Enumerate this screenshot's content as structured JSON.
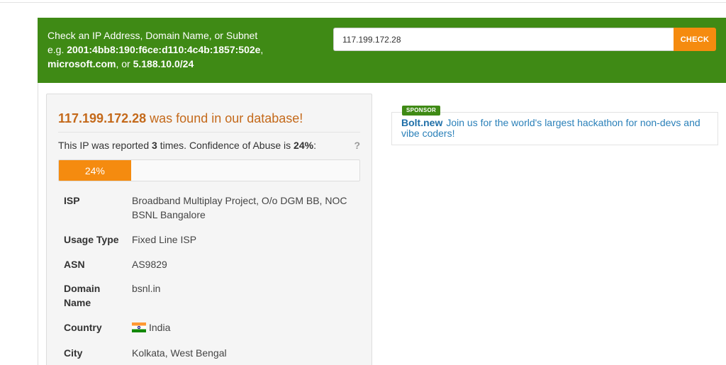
{
  "header": {
    "line1": "Check an IP Address, Domain Name, or Subnet",
    "eg_prefix": "e.g.",
    "example_ipv6": "2001:4bb8:190:f6ce:d110:4c4b:1857:502e",
    "comma1": ",",
    "example_domain": "microsoft.com",
    "or_text": ", or",
    "example_subnet": "5.188.10.0/24"
  },
  "search": {
    "value": "117.199.172.28",
    "button_label": "CHECK"
  },
  "result": {
    "ip": "117.199.172.28",
    "found_text": "was found in our database!",
    "report_prefix": "This IP was reported",
    "report_count": "3",
    "report_mid": "times. Confidence of Abuse is",
    "confidence": "24%",
    "report_suffix": ":",
    "help": "?",
    "progress_label": "24%",
    "progress_value": 24
  },
  "details": [
    {
      "key": "ISP",
      "value": "Broadband Multiplay Project, O/o DGM BB, NOC BSNL Bangalore"
    },
    {
      "key": "Usage Type",
      "value": "Fixed Line ISP"
    },
    {
      "key": "ASN",
      "value": "AS9829"
    },
    {
      "key": "Domain Name",
      "value": "bsnl.in"
    },
    {
      "key": "Country",
      "value": "India",
      "flag": "india-flag-icon"
    },
    {
      "key": "City",
      "value": "Kolkata, West Bengal"
    }
  ],
  "sponsor": {
    "badge": "SPONSOR",
    "brand": "Bolt.new",
    "text": "Join us for the world's largest hackathon for non-devs and vibe coders!"
  },
  "colors": {
    "header_green": "#3f8a15",
    "accent_orange": "#f58b0f",
    "title_orange": "#c4691a",
    "link_blue": "#2a80b9"
  }
}
